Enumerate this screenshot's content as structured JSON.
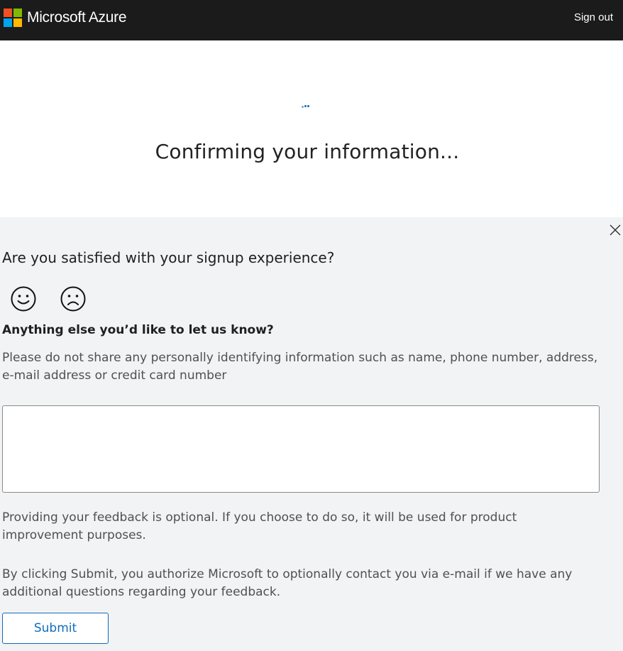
{
  "header": {
    "brand_name": "Microsoft Azure",
    "logo_colors": [
      "#f25022",
      "#7fba00",
      "#00a4ef",
      "#ffb900"
    ],
    "sign_out_label": "Sign out",
    "background": "#1b1b1b"
  },
  "status": {
    "title": "Confirming your information...",
    "spinner_color": "#0f6cbd"
  },
  "feedback": {
    "close_icon": "close-icon",
    "question": "Are you satisfied with your signup experience?",
    "satisfied_icon": "smiley-happy-icon",
    "dissatisfied_icon": "smiley-sad-icon",
    "followup_question": "Anything else you’d like to let us know?",
    "privacy_note": "Please do not share any personally identifying information such as name, phone number, address, e-mail address or credit card number",
    "comment_value": "",
    "optional_note": "Providing your feedback is optional. If you choose to do so, it will be used for product improvement purposes.",
    "authorize_note": "By clicking Submit, you authorize Microsoft to optionally contact you via e-mail if we have any additional questions regarding your feedback.",
    "submit_label": "Submit",
    "accent_color": "#0f6cbd",
    "panel_background": "#f2f3f5"
  }
}
